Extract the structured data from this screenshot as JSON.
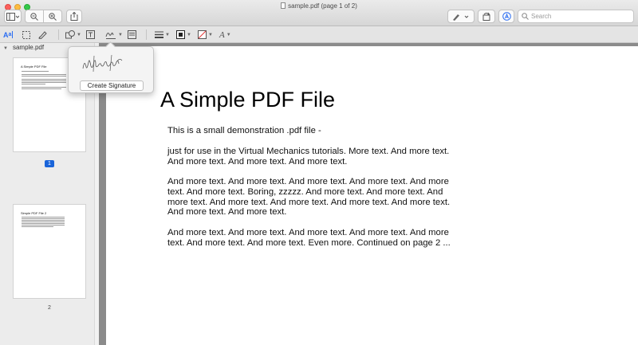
{
  "window": {
    "title": "sample.pdf (page 1 of 2)"
  },
  "search": {
    "placeholder": "Search"
  },
  "sidebar": {
    "file_name": "sample.pdf",
    "thumbnails": [
      {
        "title": "A Simple PDF File",
        "page_label": "1"
      },
      {
        "title": "Simple PDF File 2",
        "page_label": "2"
      }
    ]
  },
  "signature_popover": {
    "create_label": "Create Signature",
    "signature_text": "Wellingzak"
  },
  "document": {
    "title": "A Simple PDF File",
    "paragraphs": [
      "This is a small demonstration .pdf file -",
      "just for use in the Virtual Mechanics tutorials. More text. And more text. And more text. And more text. And more text.",
      "And more text. And more text. And more text. And more text. And more text. And more text. Boring, zzzzz. And more text. And more text. And more text. And more text. And more text. And more text. And more text. And more text. And more text.",
      "And more text. And more text. And more text. And more text. And more text. And more text. And more text. Even more. Continued on page 2 ..."
    ]
  },
  "icons": {
    "sidebar_toggle": "sidebar-icon",
    "zoom_out": "zoom-out-icon",
    "zoom_in": "zoom-in-icon",
    "share": "share-icon",
    "pen": "pen-icon",
    "rotate": "rotate-icon",
    "markup": "markup-icon",
    "search": "search-icon"
  },
  "colors": {
    "selection_blue": "#1a64d9",
    "markup_blue": "#2a6df2"
  }
}
